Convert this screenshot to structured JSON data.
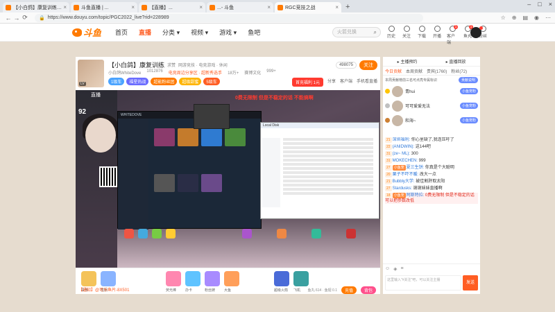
{
  "browser": {
    "tabs": [
      {
        "title": "【小白鸽】康复训练 - 斗鱼",
        "active": false
      },
      {
        "title": "斗鱼直播 | ...",
        "active": false
      },
      {
        "title": "【直播】...",
        "active": false
      },
      {
        "title": "...- 斗鱼",
        "active": false
      },
      {
        "title": "RGC竞技之战",
        "active": true
      }
    ],
    "url": "https://www.douyu.com/topic/PGC2022_live?rid=228989"
  },
  "site": {
    "logo_text": "斗鱼",
    "nav": [
      "首页",
      "直播",
      "分类",
      "视频",
      "游戏",
      "鱼吧"
    ],
    "nav_active": "直播",
    "search_placeholder": "火箭兑换",
    "tools": [
      {
        "label": "历史",
        "badge": ""
      },
      {
        "label": "关注",
        "badge": ""
      },
      {
        "label": "下载",
        "badge": ""
      },
      {
        "label": "开播",
        "badge": ""
      },
      {
        "label": "客户端",
        "badge": "1"
      },
      {
        "label": "鱼丸",
        "badge": "1"
      },
      {
        "label": "粉丝",
        "badge": ""
      }
    ]
  },
  "room": {
    "title": "【小白鸽】康复训练",
    "tag": "求赞",
    "category": "网游竞技 · 电竞游戏 · 休闲",
    "streamer": "小白鸽WhiteDove",
    "rid": "1012876",
    "hot": "电竞周边分享区 · 超新秀选手",
    "fans": "18万+",
    "level_text": "赛博文化",
    "watchers": "999+",
    "badges": [
      {
        "text": "1级车",
        "color": "#4aa3ff"
      },
      {
        "text": "福星热战",
        "color": "#6a6cff"
      },
      {
        "text": "超能粉丝团",
        "color": "#ff7a00"
      },
      {
        "text": "超级甜蜜",
        "color": "#ffb400"
      },
      {
        "text": "5级车",
        "color": "#ff5d23"
      }
    ],
    "follow_count": "498075",
    "follow_label": "关注",
    "welfare": "首充福利 1元",
    "links": [
      "分享",
      "客户端",
      "手机看直播"
    ]
  },
  "video": {
    "label": "直播",
    "overlay_num": "92",
    "overlay_red": "0费无限制 但是不稳定的话 不能搞啊",
    "win_dark_title": "WHITEDOVE",
    "win_light_title": "Local Disk"
  },
  "gifts": {
    "items": [
      "贵族",
      "签到",
      "荧光棒",
      "办卡",
      "粉丝牌",
      "大鱼",
      "超级火箭",
      "飞机"
    ],
    "bottom_text": "【通知】@可乐鱼片-8X501",
    "meta": "鱼丸 614 · 鱼翅 0.1",
    "charge": "充值",
    "backpack": "背包"
  },
  "chat": {
    "top": [
      "主播预约",
      "直播回放"
    ],
    "tabs": [
      "今日贡献",
      "本周贡献",
      "贵宾(1760)",
      "粉丝(72)"
    ],
    "note": "本周贡献榜前三名可点亮专属标识",
    "note_btn": "贡献说明",
    "ranks": [
      {
        "name": "青hui",
        "badge": "小鱼宠粉",
        "medal": "#ffc400"
      },
      {
        "name": "可可爱爱无法",
        "badge": "小鱼宠粉",
        "medal": "#c0c0c0"
      },
      {
        "name": "和海~",
        "badge": "小鱼宠粉",
        "medal": "#cd7f32"
      }
    ],
    "messages": [
      {
        "lvl": "21",
        "fan": "",
        "nick": "深圳福利:",
        "text": "你心里缺了,我连压吁了",
        "hl": false
      },
      {
        "lvl": "22",
        "fan": "",
        "nick": "(ANIDWIN):",
        "text": "这144吧",
        "hl": false
      },
      {
        "lvl": "31",
        "fan": "",
        "nick": "(ze~ ML):",
        "text": "300",
        "hl": false
      },
      {
        "lvl": "31",
        "fan": "",
        "nick": "MOKECHEN:",
        "text": "999",
        "hl": false
      },
      {
        "lvl": "27",
        "fan": "小鱼宠",
        "nick": "夏三生饼:",
        "text": "你真是个大聪明",
        "hl": false
      },
      {
        "lvl": "20",
        "fan": "",
        "nick": "栗子不吓不暖:",
        "text": "改大一点",
        "hl": false
      },
      {
        "lvl": "21",
        "fan": "",
        "nick": "Bubbly大学:",
        "text": "被佳割肝取太阳",
        "hl": false
      },
      {
        "lvl": "27",
        "fan": "",
        "nick": "Stardusks:",
        "text": "谢谢妹妹直播啊",
        "hl": false
      },
      {
        "lvl": "18",
        "fan": "小鱼宠",
        "nick": "阿斯特拉:",
        "text": "0费无限制 但是不稳定的话 可以把参数改低",
        "hl": true
      }
    ],
    "input_placeholder": "这里输入\"#关注\"吧，可以关注主播",
    "send": "发送"
  }
}
